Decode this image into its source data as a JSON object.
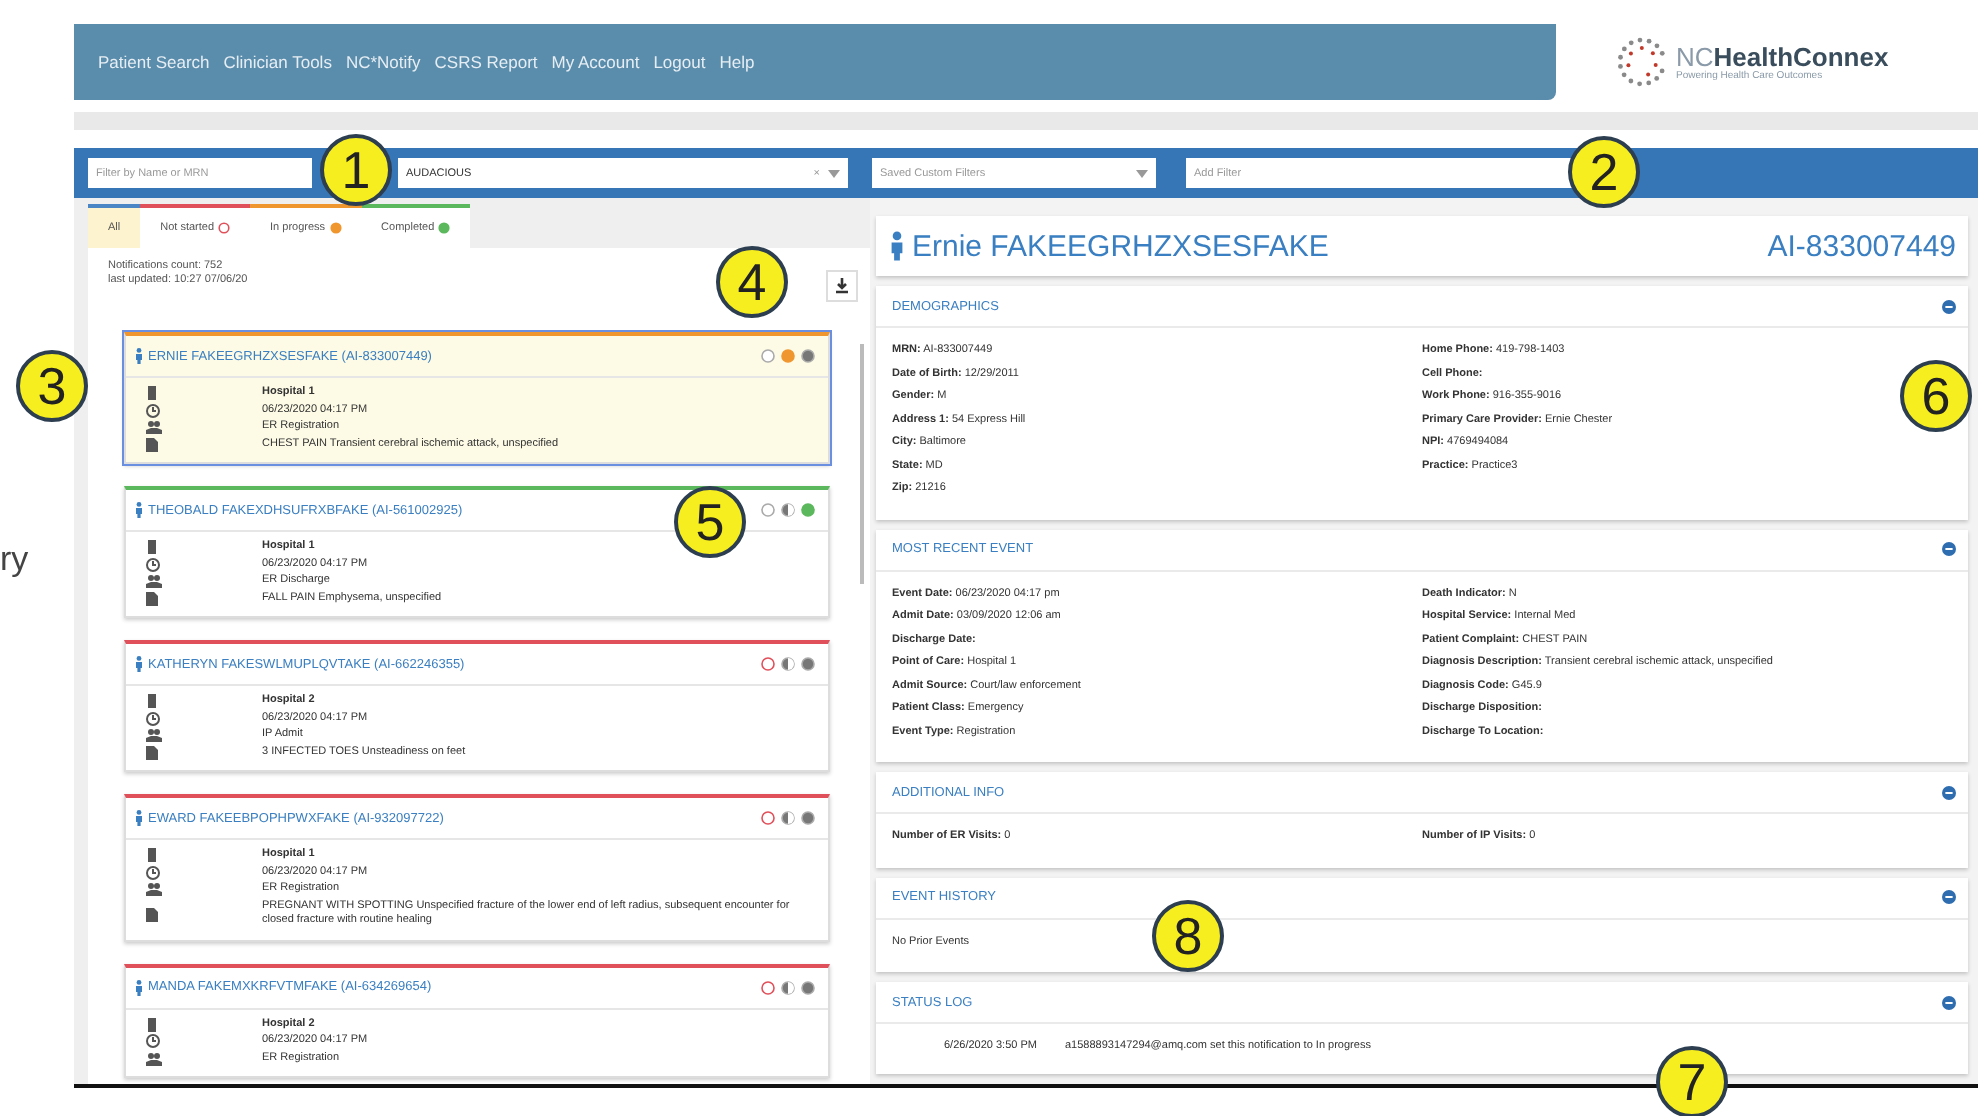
{
  "nav": {
    "items": [
      "Patient Search",
      "Clinician Tools",
      "NC*Notify",
      "CSRS Report",
      "My Account",
      "Logout",
      "Help"
    ]
  },
  "logo": {
    "prefix": "NC",
    "name": "HealthConnex",
    "tagline": "Powering Health Care Outcomes"
  },
  "filters": {
    "name_field": {
      "placeholder": "Filter by Name or MRN"
    },
    "organization": {
      "value": "AUDACIOUS",
      "clear": "×"
    },
    "saved": {
      "placeholder": "Saved Custom Filters"
    },
    "add": {
      "placeholder": "Add Filter"
    }
  },
  "tabs": [
    {
      "label": "All",
      "kind": "all",
      "selected": true
    },
    {
      "label": "Not started",
      "kind": "not_started",
      "selected": false
    },
    {
      "label": "In progress",
      "kind": "in_progress",
      "selected": false
    },
    {
      "label": "Completed",
      "kind": "completed",
      "selected": false
    }
  ],
  "notifications": {
    "count": "Notifications count: 752",
    "updated": "last updated: 10:27 07/06/20"
  },
  "cards": [
    {
      "name": "ERNIE FAKEEGRHZXSESFAKE (AI-833007449)",
      "kind": "in_progress",
      "selected": true,
      "facility": "Hospital 1",
      "time": "06/23/2020 04:17 PM",
      "event": "ER Registration",
      "diagnosis": "CHEST PAIN Transient cerebral ischemic attack, unspecified"
    },
    {
      "name": "THEOBALD FAKEXDHSUFRXBFAKE (AI-561002925)",
      "kind": "completed",
      "selected": false,
      "facility": "Hospital 1",
      "time": "06/23/2020 04:17 PM",
      "event": "ER Discharge",
      "diagnosis": "FALL PAIN Emphysema, unspecified"
    },
    {
      "name": "KATHERYN FAKESWLMUPLQVTAKE (AI-662246355)",
      "kind": "not_started",
      "selected": false,
      "facility": "Hospital 2",
      "time": "06/23/2020 04:17 PM",
      "event": "IP Admit",
      "diagnosis": "3 INFECTED TOES Unsteadiness on feet"
    },
    {
      "name": "EWARD FAKEEBPOPHPWXFAKE (AI-932097722)",
      "kind": "not_started",
      "selected": false,
      "facility": "Hospital 1",
      "time": "06/23/2020 04:17 PM",
      "event": "ER Registration",
      "diagnosis": "PREGNANT WITH SPOTTING Unspecified fracture of the lower end of left radius, subsequent encounter for closed fracture with routine healing"
    },
    {
      "name": "MANDA FAKEMXKRFVTMFAKE (AI-634269654)",
      "kind": "not_started",
      "selected": false,
      "facility": "Hospital 2",
      "time": "06/23/2020 04:17 PM",
      "event": "ER Registration"
    }
  ],
  "patient": {
    "name": "Ernie FAKEEGRHZXSESFAKE",
    "id": "AI-833007449"
  },
  "sections": [
    {
      "title": "DEMOGRAPHICS",
      "kind": "fields",
      "left": [
        {
          "label": "MRN:",
          "value": "AI-833007449"
        },
        {
          "label": "Date of Birth:",
          "value": "12/29/2011"
        },
        {
          "label": "Gender:",
          "value": "M"
        },
        {
          "label": "Address 1:",
          "value": "54 Express Hill"
        },
        {
          "label": "City:",
          "value": "Baltimore"
        },
        {
          "label": "State:",
          "value": "MD"
        },
        {
          "label": "Zip:",
          "value": "21216"
        }
      ],
      "right": [
        {
          "label": "Home Phone:",
          "value": "419-798-1403"
        },
        {
          "label": "Cell Phone:"
        },
        {
          "label": "Work Phone:",
          "value": "916-355-9016"
        },
        {
          "label": "Primary Care Provider:",
          "value": "Ernie Chester"
        },
        {
          "label": "NPI:",
          "value": "4769494084"
        },
        {
          "label": "Practice:",
          "value": "Practice3"
        }
      ]
    },
    {
      "title": "MOST RECENT EVENT",
      "kind": "fields",
      "left": [
        {
          "label": "Event Date:",
          "value": "06/23/2020 04:17 pm"
        },
        {
          "label": "Admit Date:",
          "value": "03/09/2020 12:06 am"
        },
        {
          "label": "Discharge Date:"
        },
        {
          "label": "Point of Care:",
          "value": "Hospital 1"
        },
        {
          "label": "Admit Source:",
          "value": "Court/law enforcement"
        },
        {
          "label": "Patient Class:",
          "value": "Emergency"
        },
        {
          "label": "Event Type:",
          "value": "Registration"
        }
      ],
      "right": [
        {
          "label": "Death Indicator:",
          "value": "N"
        },
        {
          "label": "Hospital Service:",
          "value": "Internal Med"
        },
        {
          "label": "Patient Complaint:",
          "value": "CHEST PAIN"
        },
        {
          "label": "Diagnosis Description:",
          "value": "Transient cerebral ischemic attack, unspecified"
        },
        {
          "label": "Diagnosis Code:",
          "value": "G45.9"
        },
        {
          "label": "Discharge Disposition:"
        },
        {
          "label": "Discharge To Location:"
        }
      ]
    },
    {
      "title": "ADDITIONAL INFO",
      "kind": "fields",
      "left": [
        {
          "label": "Number of ER Visits:",
          "value": "0"
        }
      ],
      "right": [
        {
          "label": "Number of IP Visits:",
          "value": "0"
        }
      ]
    },
    {
      "title": "EVENT HISTORY",
      "kind": "text",
      "text": "No Prior Events"
    },
    {
      "title": "STATUS LOG",
      "kind": "log",
      "entries": [
        {
          "time": "6/26/2020 3:50 PM",
          "text": "a1588893147294@amq.com set this notification to In progress"
        }
      ]
    }
  ],
  "slide_fragment": "ry",
  "callouts": [
    "1",
    "2",
    "3",
    "4",
    "5",
    "6",
    "7",
    "8"
  ]
}
